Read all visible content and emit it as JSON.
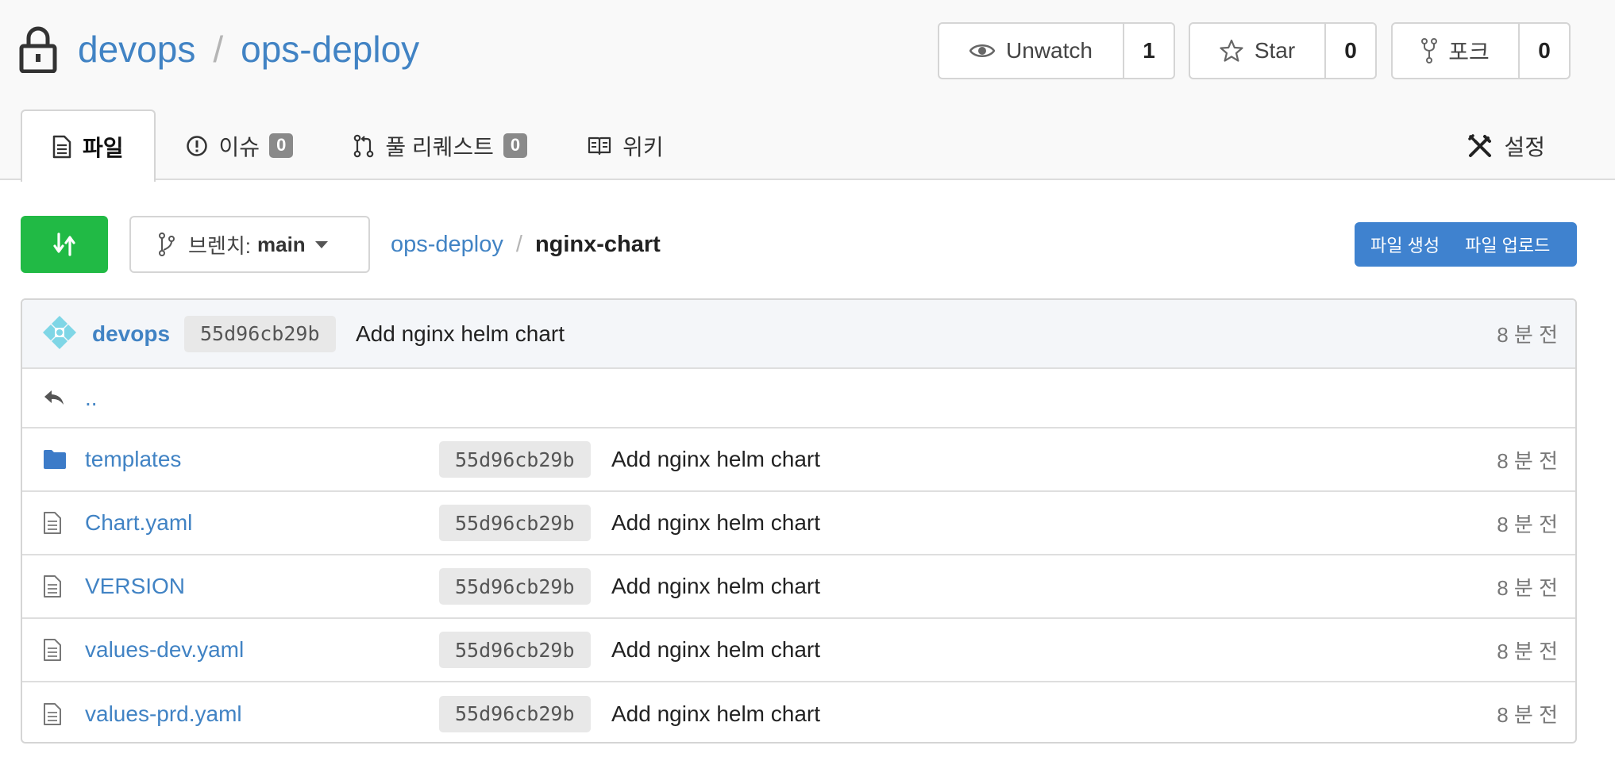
{
  "repo": {
    "owner": "devops",
    "separator": "/",
    "name": "ops-deploy"
  },
  "actions": {
    "watch": {
      "label": "Unwatch",
      "count": "1"
    },
    "star": {
      "label": "Star",
      "count": "0"
    },
    "fork": {
      "label": "포크",
      "count": "0"
    }
  },
  "tabs": [
    {
      "label": "파일"
    },
    {
      "label": "이슈",
      "badge": "0"
    },
    {
      "label": "풀 리퀘스트",
      "badge": "0"
    },
    {
      "label": "위키"
    }
  ],
  "settings": {
    "label": "설정"
  },
  "branch": {
    "prefix": "브렌치:",
    "name": "main"
  },
  "breadcrumb": {
    "root": "ops-deploy",
    "separator": "/",
    "current": "nginx-chart"
  },
  "file_actions": {
    "new_file": "파일 생성",
    "upload_file": "파일 업로드"
  },
  "latest_commit": {
    "author": "devops",
    "sha": "55d96cb29b",
    "message": "Add nginx helm chart",
    "age": "8 분 전"
  },
  "parent_dir": "..",
  "files": [
    {
      "name": "templates",
      "type": "folder",
      "sha": "55d96cb29b",
      "message": "Add nginx helm chart",
      "age": "8 분 전"
    },
    {
      "name": "Chart.yaml",
      "type": "file",
      "sha": "55d96cb29b",
      "message": "Add nginx helm chart",
      "age": "8 분 전"
    },
    {
      "name": "VERSION",
      "type": "file",
      "sha": "55d96cb29b",
      "message": "Add nginx helm chart",
      "age": "8 분 전"
    },
    {
      "name": "values-dev.yaml",
      "type": "file",
      "sha": "55d96cb29b",
      "message": "Add nginx helm chart",
      "age": "8 분 전"
    },
    {
      "name": "values-prd.yaml",
      "type": "file",
      "sha": "55d96cb29b",
      "message": "Add nginx helm chart",
      "age": "8 분 전"
    }
  ],
  "colors": {
    "link": "#4183c4",
    "compare_button": "#21ba45",
    "primary_button": "#3f82cf",
    "badge": "#8a8a8a"
  }
}
